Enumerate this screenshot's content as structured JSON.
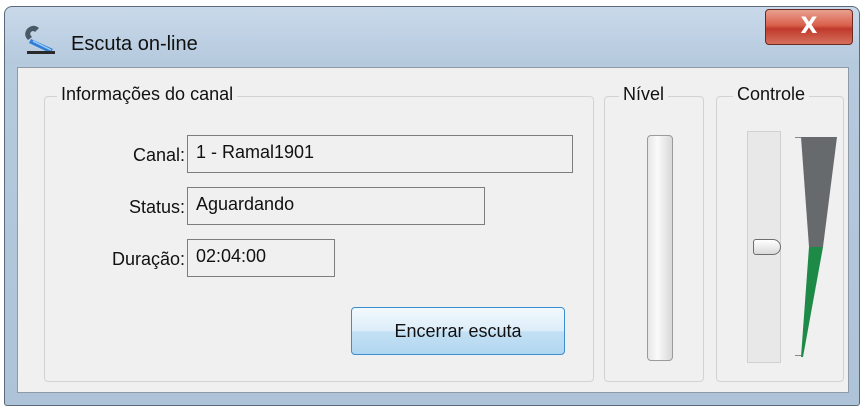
{
  "window": {
    "title": "Escuta on-line",
    "close_glyph": "X",
    "icon": "app-telephone-icon"
  },
  "info": {
    "group_title": "Informações do canal",
    "canal_label": "Canal:",
    "canal_value": "1 - Ramal1901",
    "status_label": "Status:",
    "status_value": "Aguardando",
    "duracao_label": "Duração:",
    "duracao_value": "02:04:00",
    "stop_button": "Encerrar escuta"
  },
  "nivel": {
    "group_title": "Nível",
    "level": 0
  },
  "controle": {
    "group_title": "Controle",
    "volume_level": 0.5
  },
  "colors": {
    "ramp_upper": "#676a6d",
    "ramp_lower": "#1e8a48",
    "close_button": "#c0392b"
  }
}
